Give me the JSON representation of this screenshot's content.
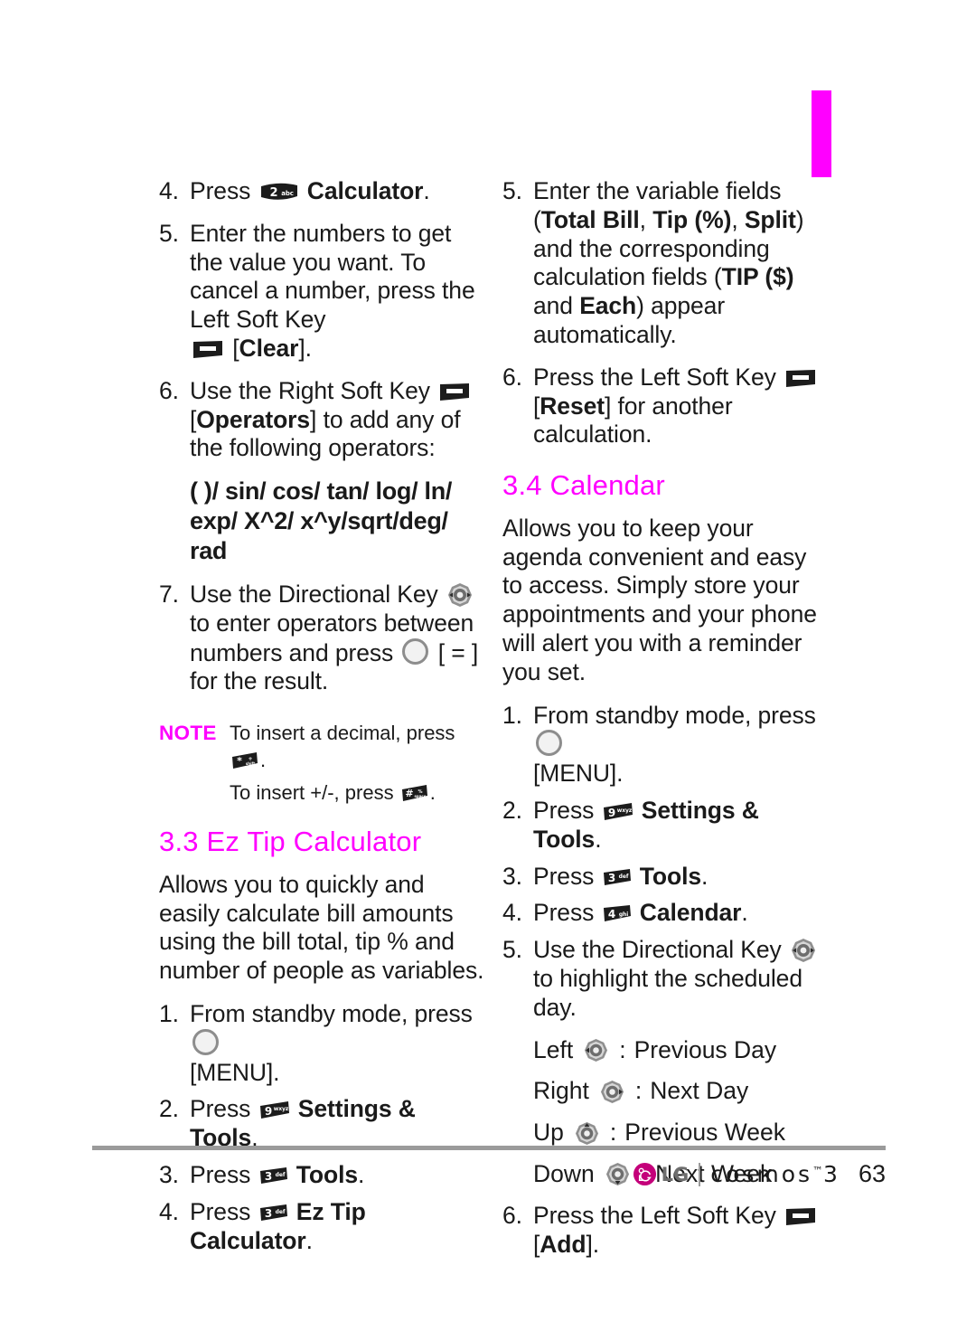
{
  "page": {
    "number": "63",
    "chapter_tab_color": "#ff00ff",
    "accent_color": "#ff00ff"
  },
  "footer": {
    "brand": "LG",
    "product": "cosmos",
    "product_tm": "™",
    "product_gen": "3",
    "page_number": "63"
  },
  "left_column": {
    "steps_calculator": [
      {
        "num": "4.",
        "pre": "Press",
        "icon": "key-2-abc",
        "post": "Calculator",
        "post_bold": true,
        "tail": "."
      },
      {
        "num": "5.",
        "text": "Enter the numbers to get the value you want. To cancel a number, press the Left Soft Key",
        "icon": "left-soft-key",
        "bracket": "[Clear].",
        "bracket_bold_inner": "Clear"
      },
      {
        "num": "6.",
        "pre": "Use the Right Soft Key",
        "icon": "right-soft-key",
        "bracket_open": "[",
        "bracket_bold_inner": "Operators",
        "bracket_close": "]",
        "post": "to add any of the following operators:"
      }
    ],
    "operators_line1": "( )/ sin/ cos/ tan/ log/ ln/",
    "operators_line2": "exp/ X^2/ x^y/sqrt/deg/ rad",
    "step7": {
      "num": "7.",
      "pre": "Use the Directional Key",
      "icon": "directional-key",
      "mid": "to enter operators between numbers and press",
      "icon2": "ok-key",
      "post": "[ = ] for the result."
    },
    "note": {
      "label": "NOTE",
      "line1_pre": "To insert a decimal, press",
      "line1_icon": "key-star",
      "line1_post": ".",
      "line2_pre": "To insert +/-, press",
      "line2_icon": "key-pound",
      "line2_post": "."
    },
    "section_3_3": {
      "heading": "3.3 Ez Tip Calculator",
      "intro": "Allows you to quickly and easily calculate bill amounts using the bill total, tip % and number of people as variables.",
      "steps": [
        {
          "num": "1.",
          "pre": "From standby mode, press",
          "icon": "ok-key",
          "post": "[MENU]."
        },
        {
          "num": "2.",
          "pre": "Press",
          "icon": "key-9-wxyz",
          "label": "Settings & Tools",
          "tail": "."
        },
        {
          "num": "3.",
          "pre": "Press",
          "icon": "key-3-def",
          "label": "Tools",
          "tail": "."
        },
        {
          "num": "4.",
          "pre": "Press",
          "icon": "key-3-def",
          "label": "Ez Tip Calculator",
          "tail": "."
        }
      ]
    }
  },
  "right_column": {
    "step5": {
      "num": "5.",
      "t1": "Enter the variable fields (",
      "b1": "Total Bill",
      "t2": ", ",
      "b2": "Tip (%)",
      "t3": ", ",
      "b3": "Split",
      "t4": ") and the corresponding calculation fields (",
      "b4": "TIP ($)",
      "t5": " and ",
      "b5": "Each",
      "t6": ") appear automatically."
    },
    "step6": {
      "num": "6.",
      "pre": "Press the Left Soft Key",
      "icon": "left-soft-key",
      "bracket_open": "[",
      "bracket_bold_inner": "Reset",
      "bracket_close": "]",
      "post": "for another calculation."
    },
    "section_3_4": {
      "heading": "3.4 Calendar",
      "intro": "Allows you to keep your agenda convenient and easy to access. Simply store your appointments and your phone will alert you with a reminder you set.",
      "steps": [
        {
          "num": "1.",
          "pre": "From standby mode, press",
          "icon": "ok-key",
          "post": "[MENU]."
        },
        {
          "num": "2.",
          "pre": "Press",
          "icon": "key-9-wxyz",
          "label": "Settings & Tools",
          "tail": "."
        },
        {
          "num": "3.",
          "pre": "Press",
          "icon": "key-3-def",
          "label": "Tools",
          "tail": "."
        },
        {
          "num": "4.",
          "pre": "Press",
          "icon": "key-4-ghi",
          "label": "Calendar",
          "tail": "."
        },
        {
          "num": "5.",
          "pre": "Use the Directional Key",
          "icon": "directional-key",
          "post": "to highlight  the scheduled day."
        }
      ],
      "directions": [
        {
          "name": "Left",
          "icon": "dpad-left",
          "sep": ":",
          "action": "Previous Day"
        },
        {
          "name": "Right",
          "icon": "dpad-right",
          "sep": ":",
          "action": "Next Day"
        },
        {
          "name": "Up",
          "icon": "dpad-up",
          "sep": ":",
          "action": "Previous Week"
        },
        {
          "name": "Down",
          "icon": "dpad-down",
          "sep": ":",
          "action": "Next Week"
        }
      ],
      "step6": {
        "num": "6.",
        "pre": "Press the Left Soft Key",
        "icon": "left-soft-key",
        "bracket_open": "[",
        "bracket_bold_inner": "Add",
        "bracket_close": "]",
        "post": "."
      }
    }
  },
  "icons": {
    "key-2-abc": {
      "digit": "2",
      "letters": "abc"
    },
    "key-3-def": {
      "digit": "3",
      "letters": "def"
    },
    "key-4-ghi": {
      "digit": "4",
      "letters": "ghi"
    },
    "key-9-wxyz": {
      "digit": "9",
      "letters": "wxyz"
    },
    "key-star": {
      "digit": "*",
      "letters": "+shift"
    },
    "key-pound": {
      "digit": "#",
      "letters": "space"
    },
    "left-soft-key": {
      "label": "soft key"
    },
    "ok-key": {
      "label": "OK / MENU key"
    },
    "directional-key": {
      "label": "directional key"
    }
  }
}
